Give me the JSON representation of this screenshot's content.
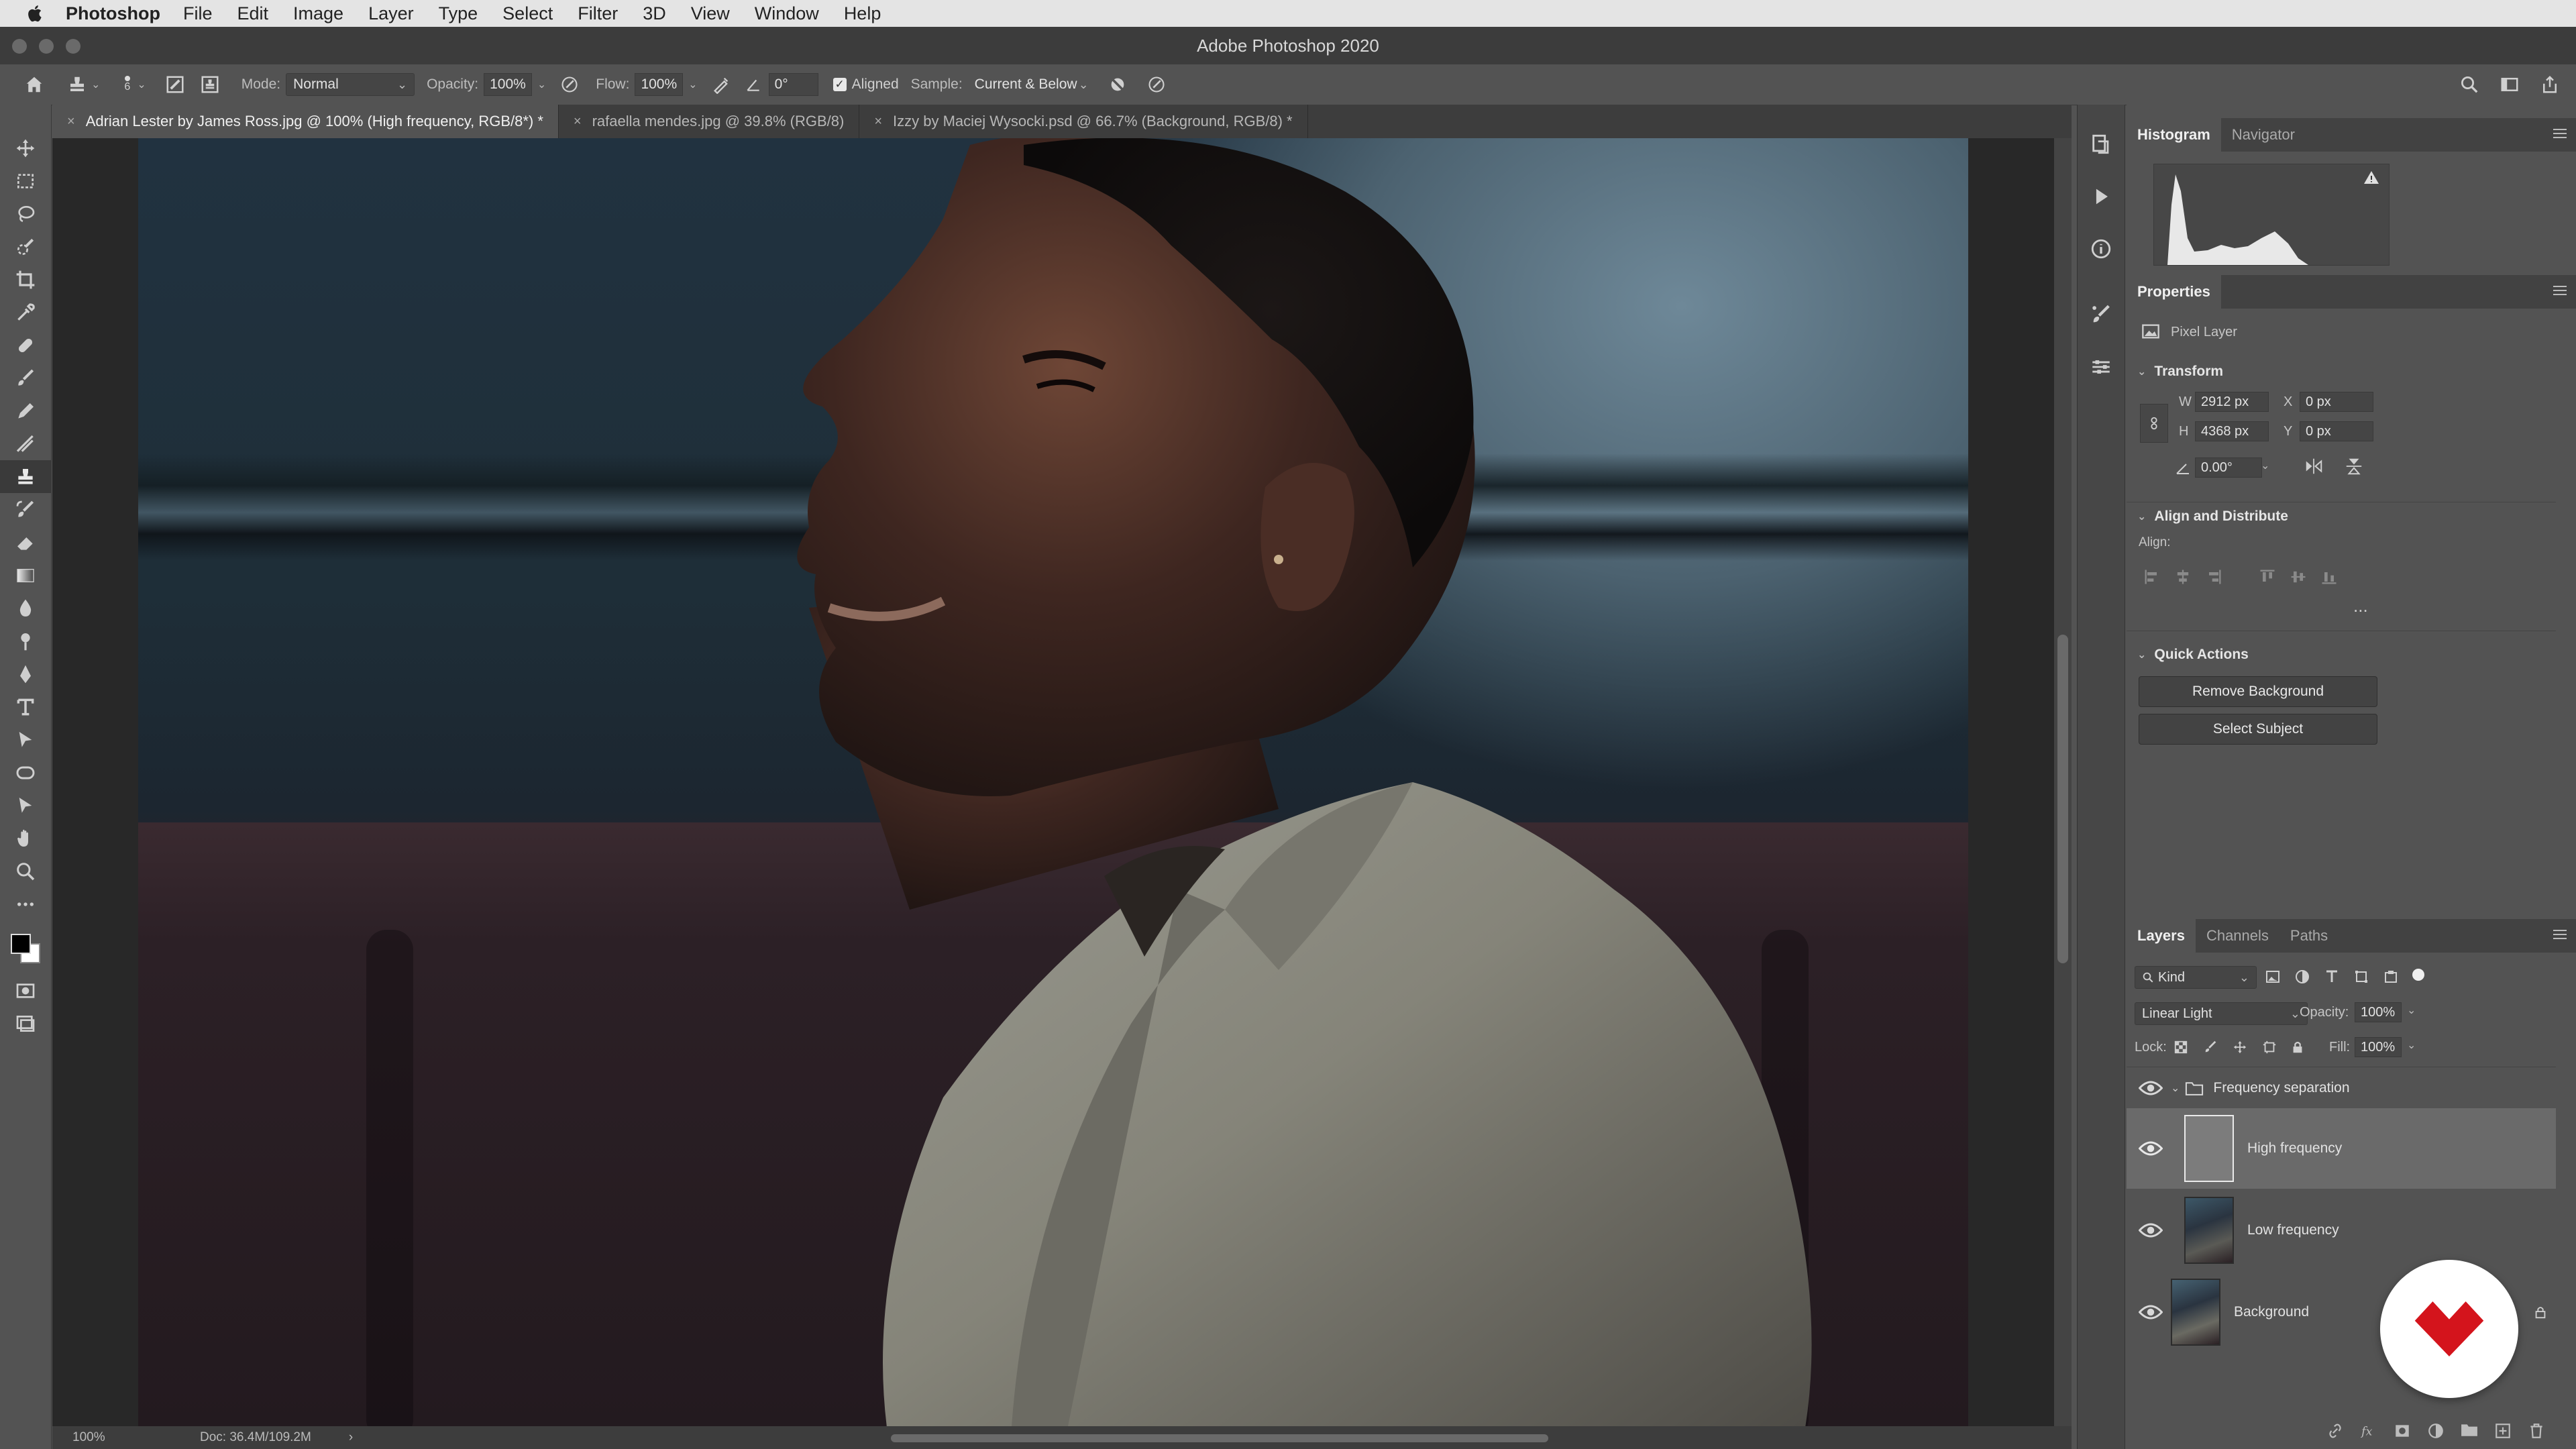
{
  "menubar": {
    "app_name": "Photoshop",
    "items": [
      "File",
      "Edit",
      "Image",
      "Layer",
      "Type",
      "Select",
      "Filter",
      "3D",
      "View",
      "Window",
      "Help"
    ]
  },
  "window": {
    "title": "Adobe Photoshop 2020"
  },
  "options_bar": {
    "brush_size": "6",
    "mode_label": "Mode:",
    "mode_value": "Normal",
    "opacity_label": "Opacity:",
    "opacity_value": "100%",
    "flow_label": "Flow:",
    "flow_value": "100%",
    "angle_value": "0°",
    "aligned_label": "Aligned",
    "aligned_checked": true,
    "sample_label": "Sample:",
    "sample_value": "Current & Below"
  },
  "document_tabs": [
    {
      "label": "Adrian Lester by James Ross.jpg @ 100% (High frequency, RGB/8*) *",
      "active": true
    },
    {
      "label": "rafaella mendes.jpg @ 39.8% (RGB/8)",
      "active": false
    },
    {
      "label": "Izzy by Maciej Wysocki.psd @ 66.7% (Background, RGB/8) *",
      "active": false
    }
  ],
  "status": {
    "zoom": "100%",
    "doc_size": "Doc: 36.4M/109.2M",
    "arrow": "›"
  },
  "histogram_panel": {
    "tabs": [
      "Histogram",
      "Navigator"
    ],
    "active_tab": "Histogram",
    "warning_icon": "warning-triangle-icon"
  },
  "properties_panel": {
    "title": "Properties",
    "layer_type": "Pixel Layer",
    "transform": {
      "title": "Transform",
      "w_label": "W",
      "w_value": "2912 px",
      "h_label": "H",
      "h_value": "4368 px",
      "x_label": "X",
      "x_value": "0 px",
      "y_label": "Y",
      "y_value": "0 px",
      "angle_value": "0.00°"
    },
    "align": {
      "title": "Align and Distribute",
      "align_label": "Align:",
      "more": "..."
    },
    "quick_actions": {
      "title": "Quick Actions",
      "buttons": [
        "Remove Background",
        "Select Subject"
      ]
    }
  },
  "layers_panel": {
    "tabs": [
      "Layers",
      "Channels",
      "Paths"
    ],
    "active_tab": "Layers",
    "filter_kind": "Kind",
    "blend_mode": "Linear Light",
    "opacity_label": "Opacity:",
    "opacity_value": "100%",
    "lock_label": "Lock:",
    "fill_label": "Fill:",
    "fill_value": "100%",
    "group": {
      "name": "Frequency separation",
      "expanded": true
    },
    "layers": [
      {
        "name": "High frequency",
        "selected": true,
        "visible": true
      },
      {
        "name": "Low frequency",
        "selected": false,
        "visible": true
      },
      {
        "name": "Background",
        "selected": false,
        "visible": true,
        "locked": true
      }
    ]
  },
  "colors": {
    "ui_dark": "#535353",
    "ui_darker": "#3d3d3d",
    "selection": "#6a6a6a",
    "brand_red": "#d4141c",
    "foreground_swatch": "#000000",
    "background_swatch": "#ffffff"
  }
}
